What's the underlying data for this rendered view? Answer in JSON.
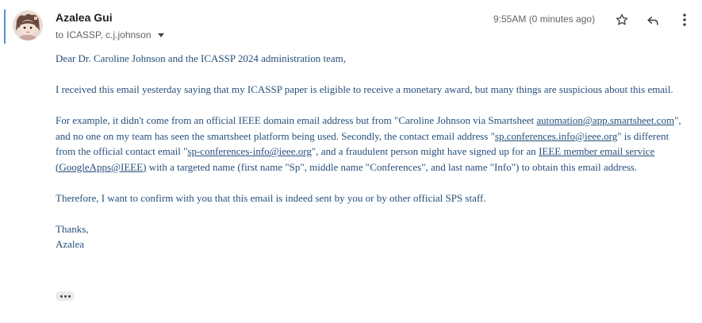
{
  "message": {
    "sender_name": "Azalea Gui",
    "recipients_prefix": "to",
    "recipients": "ICASSP, c.j.johnson",
    "timestamp": "9:55AM (0 minutes ago)"
  },
  "icons": {
    "star": "star-icon",
    "reply": "reply-icon",
    "more": "more-vert-icon",
    "dropdown": "chevron-down-icon",
    "trimmed": "more-horiz-icon"
  },
  "colors": {
    "body_text": "#254f7b",
    "accent_bar": "#5b8fd1"
  },
  "body": {
    "greeting": "Dear Dr. Caroline Johnson and the ICASSP 2024 administration team,",
    "p1": "I received this email yesterday saying that my ICASSP paper is eligible to receive a monetary award, but many things are suspicious about this email.",
    "p2_part1": "For example, it didn't come from an official IEEE domain email address but from \"Caroline Johnson via Smartsheet ",
    "p2_link1": "automation@app.smartsheet.com",
    "p2_part2": "\", and no one on my team has seen the smartsheet platform being used. Secondly, the contact email address \"",
    "p2_link2": "sp.conferences.info@ieee.org",
    "p2_part3": "\" is different from the official contact email \"",
    "p2_link3": "sp-conferences-info@ieee.org",
    "p2_part4": "\", and a fraudulent person might have signed up for an ",
    "p2_link4": "IEEE member email service (GoogleApps@IEEE)",
    "p2_part5": " with a targeted name (first name \"Sp\", middle name \"Conferences\", and last name \"Info\") to obtain this email address.",
    "p3": "Therefore, I want to confirm with you that this email is indeed sent by you or by other official SPS staff.",
    "closing": "Thanks,",
    "signature": "Azalea"
  }
}
